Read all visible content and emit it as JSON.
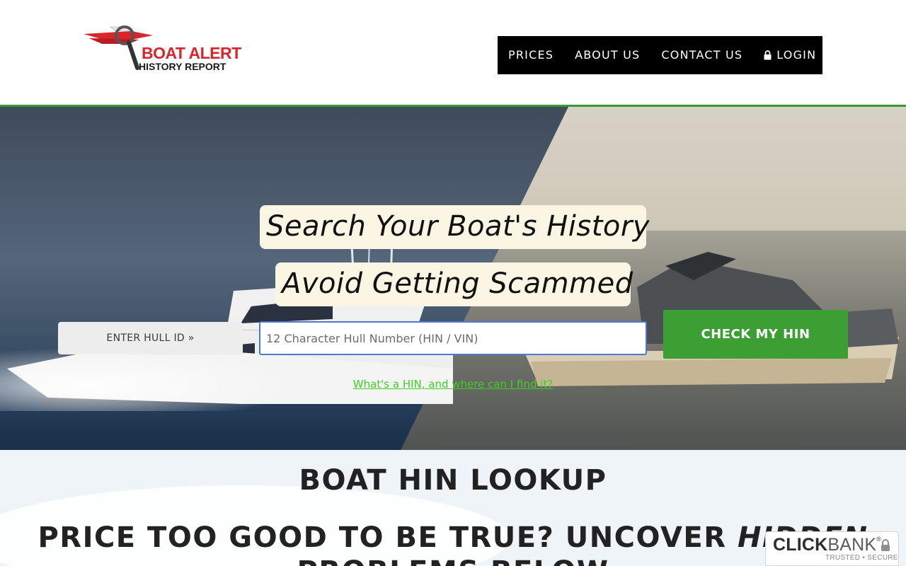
{
  "brand": {
    "logo_line1": "BOAT ALERT",
    "logo_line2": "HISTORY REPORT",
    "accent_red": "#d9262b",
    "accent_green": "#3c9f33",
    "link_green": "#3ed11f"
  },
  "nav": {
    "items": [
      {
        "label": "PRICES"
      },
      {
        "label": "ABOUT US"
      },
      {
        "label": "CONTACT US"
      },
      {
        "label": "LOGIN",
        "icon": "lock-icon"
      }
    ]
  },
  "hero": {
    "headline1": "Search Your Boat's History",
    "headline2": "Avoid Getting Scammed",
    "enter_label": "ENTER HULL ID »",
    "input_placeholder": "12 Character Hull Number (HIN / VIN)",
    "input_value": "",
    "cta_label": "CHECK MY HIN",
    "help_link": "What's a HIN, and where can I find it?"
  },
  "section": {
    "title": "BOAT HIN LOOKUP",
    "subtitle_part1": "PRICE TOO GOOD TO BE TRUE? UNCOVER ",
    "subtitle_emph": "HIDDEN",
    "subtitle_part2": "PROBLEMS BELOW"
  },
  "badge": {
    "click": "CLICK",
    "bank": "BANK",
    "reg": "®",
    "tagline": "TRUSTED • SECURE",
    "icon": "lock-icon"
  }
}
